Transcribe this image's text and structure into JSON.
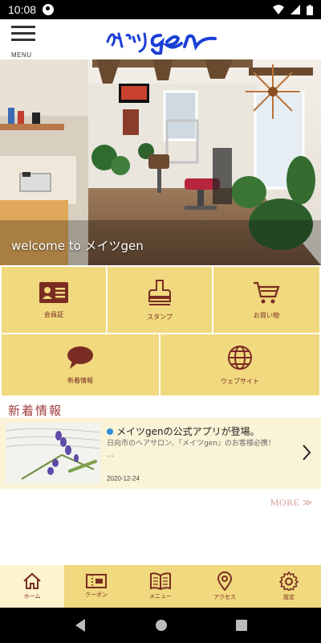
{
  "status_bar": {
    "time": "10:08"
  },
  "header": {
    "menu_label": "MENU",
    "logo_text": "メイツgen"
  },
  "hero": {
    "caption": "welcome to メイツgen"
  },
  "tiles": [
    {
      "label": "会員証",
      "icon": "member-card-icon"
    },
    {
      "label": "スタンプ",
      "icon": "stamp-icon"
    },
    {
      "label": "お買い物",
      "icon": "shopping-cart-icon"
    },
    {
      "label": "新着情報",
      "icon": "speech-bubble-icon"
    },
    {
      "label": "ウェブサイト",
      "icon": "globe-icon"
    }
  ],
  "news": {
    "section_title": "新着情報",
    "items": [
      {
        "headline": "メイツgenの公式アプリが登場。",
        "body": "日向市のヘアサロン、『メイツgen』のお客様必携！",
        "ellipsis": "…",
        "date": "2020-12-24"
      }
    ],
    "more_label": "MORE ≫"
  },
  "tabbar": [
    {
      "label": "ホーム",
      "icon": "home-icon",
      "active": true
    },
    {
      "label": "クーポン",
      "icon": "coupon-icon",
      "active": false
    },
    {
      "label": "メニュー",
      "icon": "menu-book-icon",
      "active": false
    },
    {
      "label": "アクセス",
      "icon": "location-pin-icon",
      "active": false
    },
    {
      "label": "設定",
      "icon": "gear-icon",
      "active": false
    }
  ],
  "colors": {
    "accent_tile": "#f0d97e",
    "icon_red": "#7a2c22",
    "logo_blue": "#1a3fd6",
    "news_title": "#a23b3b"
  }
}
